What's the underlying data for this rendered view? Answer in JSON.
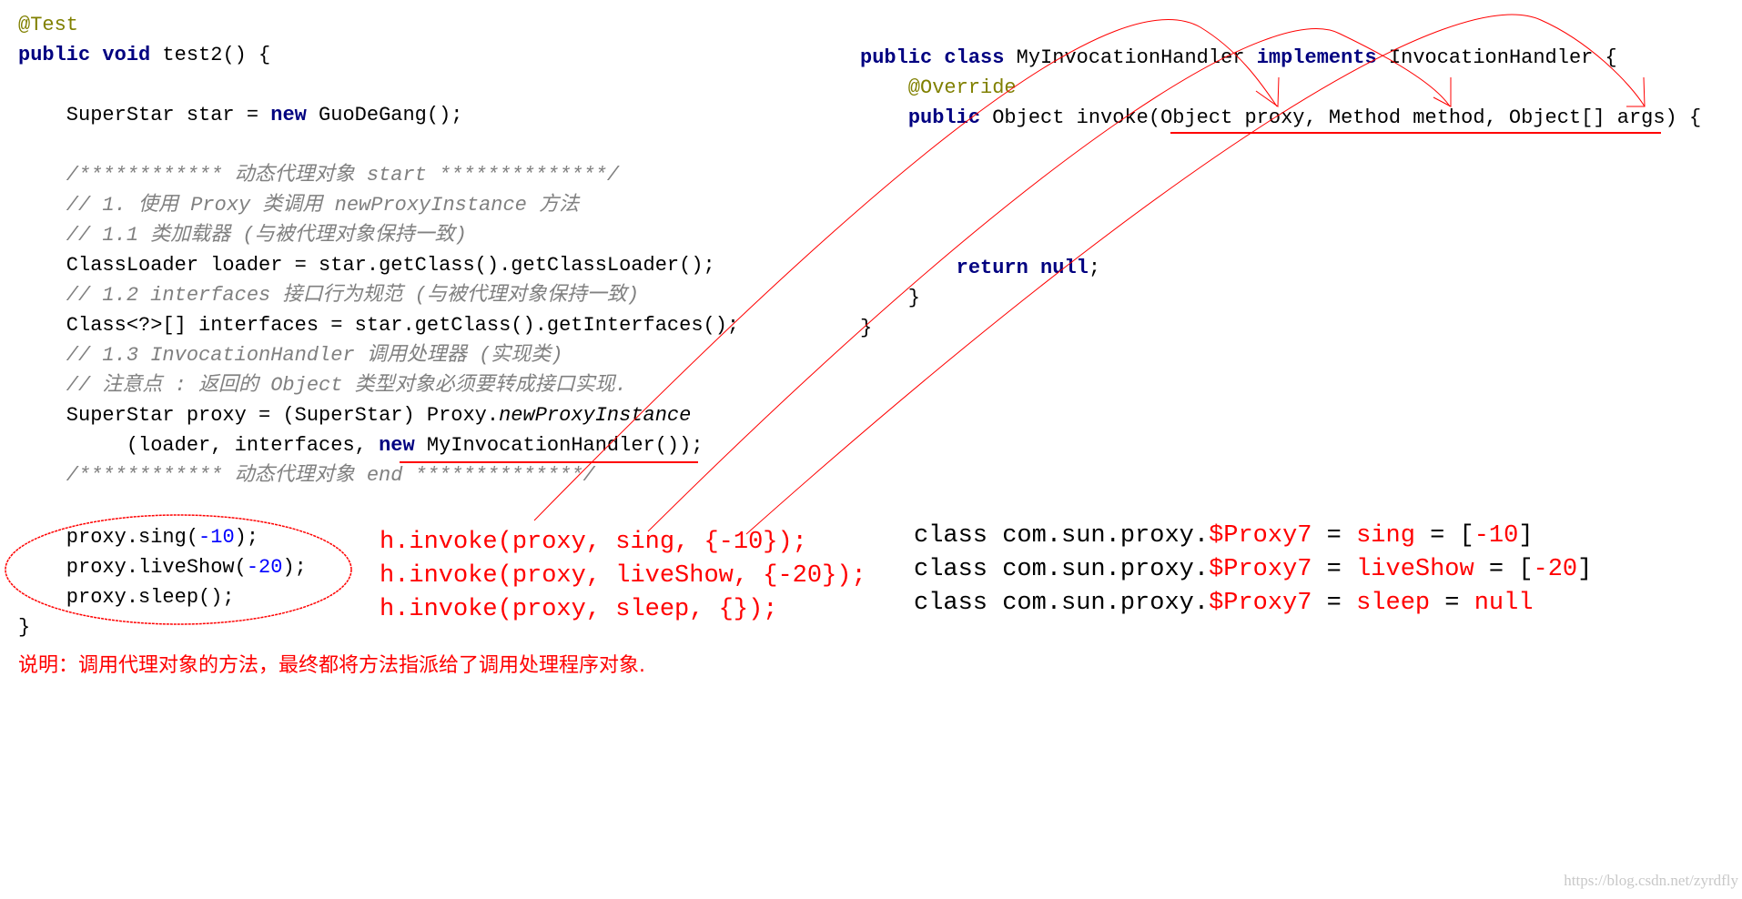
{
  "colors": {
    "keyword": "#000080",
    "annotation": "#808000",
    "comment": "#808080",
    "number": "#0000ff",
    "highlight": "#ff0000"
  },
  "left_code": [
    [
      [
        "@Test",
        "ann"
      ]
    ],
    [
      [
        "public void",
        "kw"
      ],
      [
        " test2() {",
        "pl"
      ]
    ],
    [],
    [
      [
        "    SuperStar star = ",
        "pl"
      ],
      [
        "new",
        "kw"
      ],
      [
        " GuoDeGang();",
        "pl"
      ]
    ],
    [],
    [
      [
        "    /************ 动态代理对象 start **************/",
        "cm"
      ]
    ],
    [
      [
        "    // 1. 使用 Proxy 类调用 newProxyInstance 方法",
        "cm"
      ]
    ],
    [
      [
        "    // 1.1 类加载器 (与被代理对象保持一致)",
        "cm"
      ]
    ],
    [
      [
        "    ClassLoader loader = star.getClass().getClassLoader();",
        "pl"
      ]
    ],
    [
      [
        "    // 1.2 interfaces 接口行为规范 (与被代理对象保持一致)",
        "cm"
      ]
    ],
    [
      [
        "    Class<?>[] interfaces = star.getClass().getInterfaces();",
        "pl"
      ]
    ],
    [
      [
        "    // 1.3 InvocationHandler 调用处理器 (实现类)",
        "cm"
      ]
    ],
    [
      [
        "    // 注意点 : 返回的 Object 类型对象必须要转成接口实现.",
        "cm"
      ]
    ],
    [
      [
        "    SuperStar proxy = (SuperStar) Proxy.",
        "pl"
      ],
      [
        "newProxyInstance",
        "it"
      ]
    ],
    [
      [
        "         (loader, interfaces, ",
        "pl"
      ],
      [
        "new",
        "kw"
      ],
      [
        " MyInvocationHandler());",
        "pl"
      ]
    ],
    [
      [
        "    /************ 动态代理对象 end **************/",
        "cm"
      ]
    ]
  ],
  "calls": [
    [
      [
        "    proxy.sing(",
        "pl"
      ],
      [
        "-10",
        "num"
      ],
      [
        ");",
        "pl"
      ]
    ],
    [
      [
        "    proxy.liveShow(",
        "pl"
      ],
      [
        "-20",
        "num"
      ],
      [
        ");",
        "pl"
      ]
    ],
    [
      [
        "    proxy.sleep();",
        "pl"
      ]
    ],
    [
      [
        "}",
        "pl"
      ]
    ]
  ],
  "right_code": [
    [
      [
        "public class",
        "kw"
      ],
      [
        " MyInvocationHandler ",
        "pl"
      ],
      [
        "implements",
        "kw"
      ],
      [
        " InvocationHandler {",
        "pl"
      ]
    ],
    [
      [
        "    @Override",
        "ann"
      ]
    ],
    [
      [
        "    ",
        "pl"
      ],
      [
        "public",
        "kw"
      ],
      [
        " Object invoke(Object proxy, Method method, Object[] args) {",
        "pl"
      ]
    ],
    [],
    [],
    [],
    [],
    [
      [
        "        ",
        "pl"
      ],
      [
        "return null",
        "kw"
      ],
      [
        ";",
        "pl"
      ]
    ],
    [
      [
        "    }",
        "pl"
      ]
    ],
    [
      [
        "}",
        "pl"
      ]
    ]
  ],
  "invoke_lines": [
    [
      [
        "h.invoke(proxy, sing, {-10});",
        "red"
      ]
    ],
    [
      [
        "h.invoke(proxy, liveShow, {-20});",
        "red"
      ]
    ],
    [
      [
        "h.invoke(proxy, sleep, {});",
        "red"
      ]
    ]
  ],
  "output_lines": [
    [
      [
        "class com.sun.proxy.",
        "pl"
      ],
      [
        "$Proxy7",
        "red"
      ],
      [
        " = ",
        "pl"
      ],
      [
        "sing",
        "red"
      ],
      [
        " = [",
        "pl"
      ],
      [
        "-10",
        "red"
      ],
      [
        "]",
        "pl"
      ]
    ],
    [
      [
        "class com.sun.proxy.",
        "pl"
      ],
      [
        "$Proxy7",
        "red"
      ],
      [
        " = ",
        "pl"
      ],
      [
        "liveShow",
        "red"
      ],
      [
        " = [",
        "pl"
      ],
      [
        "-20",
        "red"
      ],
      [
        "]",
        "pl"
      ]
    ],
    [
      [
        "class com.sun.proxy.",
        "pl"
      ],
      [
        "$Proxy7",
        "red"
      ],
      [
        " = ",
        "pl"
      ],
      [
        "sleep",
        "red"
      ],
      [
        " = ",
        "pl"
      ],
      [
        "null",
        "red"
      ]
    ]
  ],
  "note": "说明：调用代理对象的方法，最终都将方法指派给了调用处理程序对象.",
  "watermark": "https://blog.csdn.net/zyrdfly"
}
